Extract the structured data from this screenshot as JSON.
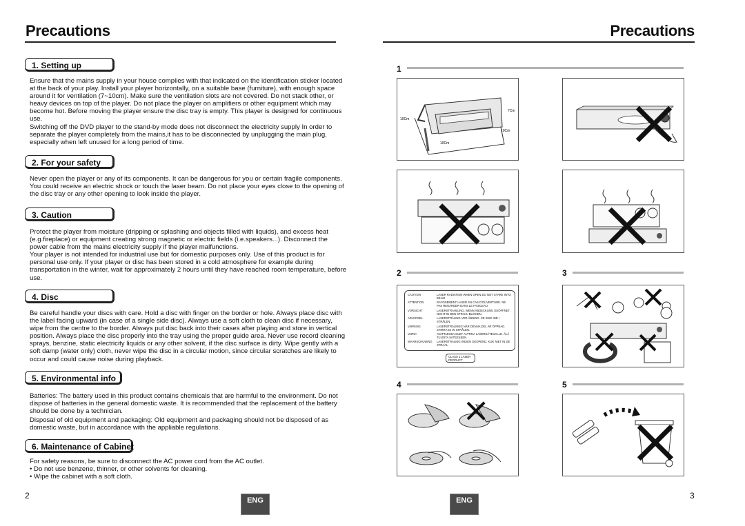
{
  "left_page": {
    "title": "Precautions",
    "page_number": "2",
    "lang_badge": "ENG",
    "sections": [
      {
        "heading": "1. Setting up",
        "paragraphs": [
          "Ensure that the mains supply in your house complies with that indicated on the identification sticker located at the back of your play. Install  your player horizontally, on a suitable base (furniture), with enough space around it for ventilation (7~10cm). Make sure the ventilation slots are not covered. Do not stack other, or heavy devices on top of the player. Do not place the player on amplifiers or other equipment which may become hot. Before moving the player ensure the disc tray is empty. This player is designed for continuous use.",
          "Switching off the DVD player to the stand-by mode does not disconnect the electricity supply In order to separate the player completely from the mains,it has to be disconnected by unplugging the main plug, especially when left unused for a long period of time."
        ]
      },
      {
        "heading": "2. For your safety",
        "paragraphs": [
          "Never open the player or any of its components. It can be dangerous for you or certain fragile components. You could receive an electric shock or touch the laser beam. Do not place your eyes close to the opening of the disc tray or any other opening to look inside the player."
        ]
      },
      {
        "heading": "3. Caution",
        "paragraphs": [
          "Protect the player from moisture (dripping or splashing and objects filled with liquids), and excess heat (e.g.fireplace) or equipment creating strong magnetic or electric fields (i.e.speakers...). Disconnect the power cable from the mains electricity supply if the player malfunctions.",
          "Your player is not intended for industrial use but  for domestic purposes only. Use of this product is for personal use only. If your player or disc has been stored in a cold atmosphere for example during transportation in the winter, wait for approximately 2 hours until they have reached room temperature, before use."
        ]
      },
      {
        "heading": "4. Disc",
        "paragraphs": [
          "Be careful handle your discs with care. Hold a disc with finger on the border or hole. Always place disc with the label facing upward (in case of a single side disc). Always use a soft cloth to clean disc if necessary, wipe from the centre to the border. Always put disc back into their cases after playing and store in vertical position. Always place the disc properly into the tray using the proper guide area. Never use record cleaning sprays, benzine, static electricity liquids or any other solvent, if the disc surface is dirty. Wipe gently with a soft damp (water only) cloth, never wipe the disc in a circular motion, since circular scratches are likely to occur and could cause noise during playback."
        ]
      },
      {
        "heading": "5. Environmental info",
        "paragraphs": [
          "Batteries: The battery used in this product contains chemicals that are harmful to the environment. Do not dispose of batteries in the general domestic waste. It is recommended that the replacement of the battery should be done by a technician.",
          "Disposal of old equipment and packaging: Old equipment and packaging should not be disposed of as domestic waste, but in accordance with the appliable regulations."
        ]
      },
      {
        "heading": "6. Maintenance of Cabinet",
        "paragraphs": [
          "For safety reasons, be sure to disconnect the AC power cord from the AC outlet."
        ],
        "bullets": [
          "Do not use benzene, thinner, or other solvents for cleaning.",
          "Wipe the cabinet with a soft cloth."
        ]
      }
    ]
  },
  "right_page": {
    "title": "Precautions",
    "page_number": "3",
    "lang_badge": "ENG",
    "figures": [
      {
        "label": "1",
        "panels": [
          "ventilation-clearance",
          "do-not-touch-tray"
        ],
        "dimension_labels": [
          "7Cm",
          "10Cm",
          "10Cm",
          "10Cm"
        ]
      },
      {
        "label": "",
        "panels": [
          "do-not-stack-on-amplifier",
          "do-not-place-on-amplifier"
        ]
      },
      {
        "label": "2",
        "panels": [
          "laser-warning-label"
        ]
      },
      {
        "label": "3",
        "panels": [
          "avoid-moisture-heat-magnets"
        ]
      },
      {
        "label": "4",
        "panels": [
          "disc-handling"
        ]
      },
      {
        "label": "5",
        "panels": [
          "battery-disposal"
        ]
      }
    ],
    "laser_label": {
      "rows": [
        {
          "key": "CAUTION",
          "text": "LASER RADIATION WHEN OPEN DO NOT STARE INTO BEAM"
        },
        {
          "key": "ATTENTION",
          "text": "RAYONEMENT LASER EN CAS D'OUVERTURE. NE PAS REGARDER DANS LE FAISCEAU."
        },
        {
          "key": "VORSICHT",
          "text": "LASERSTRAHLUNG, WENN ABDECKUNG GEÖFFNET. NICHT IN DEN STRAHL BLICKEN."
        },
        {
          "key": "ADVARSEL",
          "text": "LASERSTRÅLING VED ÅBNING. SE IKKE IND I STRÅLEN."
        },
        {
          "key": "VARNING",
          "text": "LASERSTRÅLNING NÄR DENNA DEL ÄR ÖPPNAD. STIRRA EJ IN STRÅLEN."
        },
        {
          "key": "VARO!",
          "text": "AVATTAESSA OLET ALTTINA LASERSÄTEILYLLE. ÄLÄ TUIJOTA SÄTEESEEN."
        },
        {
          "key": "WAARSCHUWING",
          "text": "LASERSTRALING INDIEN GEOPEND. KIJK NIET IN DE STRAAL."
        }
      ],
      "class_label": "CLASS 1 LASER PRODUCT"
    }
  },
  "colors": {
    "text": "#111111",
    "rule": "#222222",
    "figure_bar": "#b2b2b2",
    "badge_bg": "#4a4a4a",
    "badge_text": "#ffffff"
  }
}
